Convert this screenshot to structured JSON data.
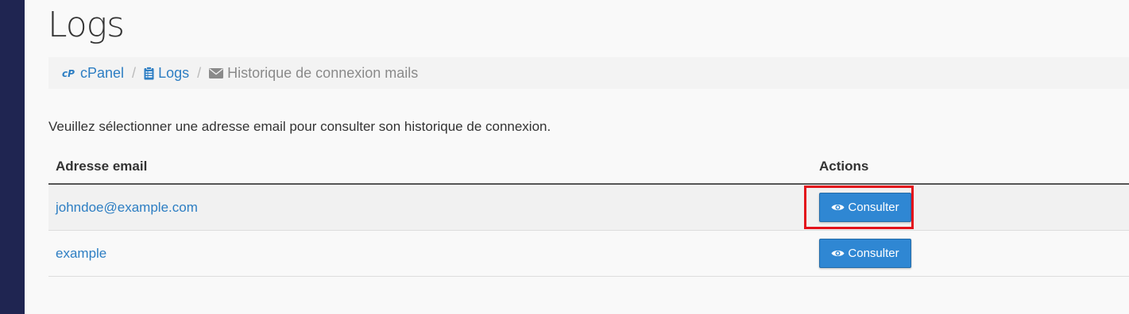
{
  "page": {
    "title": "Logs"
  },
  "breadcrumb": {
    "items": [
      {
        "label": "cPanel",
        "icon": "cpanel-logo-icon"
      },
      {
        "label": "Logs",
        "icon": "clipboard-icon"
      },
      {
        "label": "Historique de connexion mails",
        "icon": "envelope-icon"
      }
    ],
    "separator": "/"
  },
  "intro": "Veuillez sélectionner une adresse email pour consulter son historique de connexion.",
  "table": {
    "headers": {
      "email": "Adresse email",
      "actions": "Actions"
    },
    "rows": [
      {
        "email": "johndoe@example.com",
        "action_label": "Consulter"
      },
      {
        "email": "example",
        "action_label": "Consulter"
      }
    ]
  },
  "colors": {
    "sidebar": "#1f2551",
    "link": "#2d7ec3",
    "button": "#2f87d3",
    "highlight": "#e3111b"
  }
}
